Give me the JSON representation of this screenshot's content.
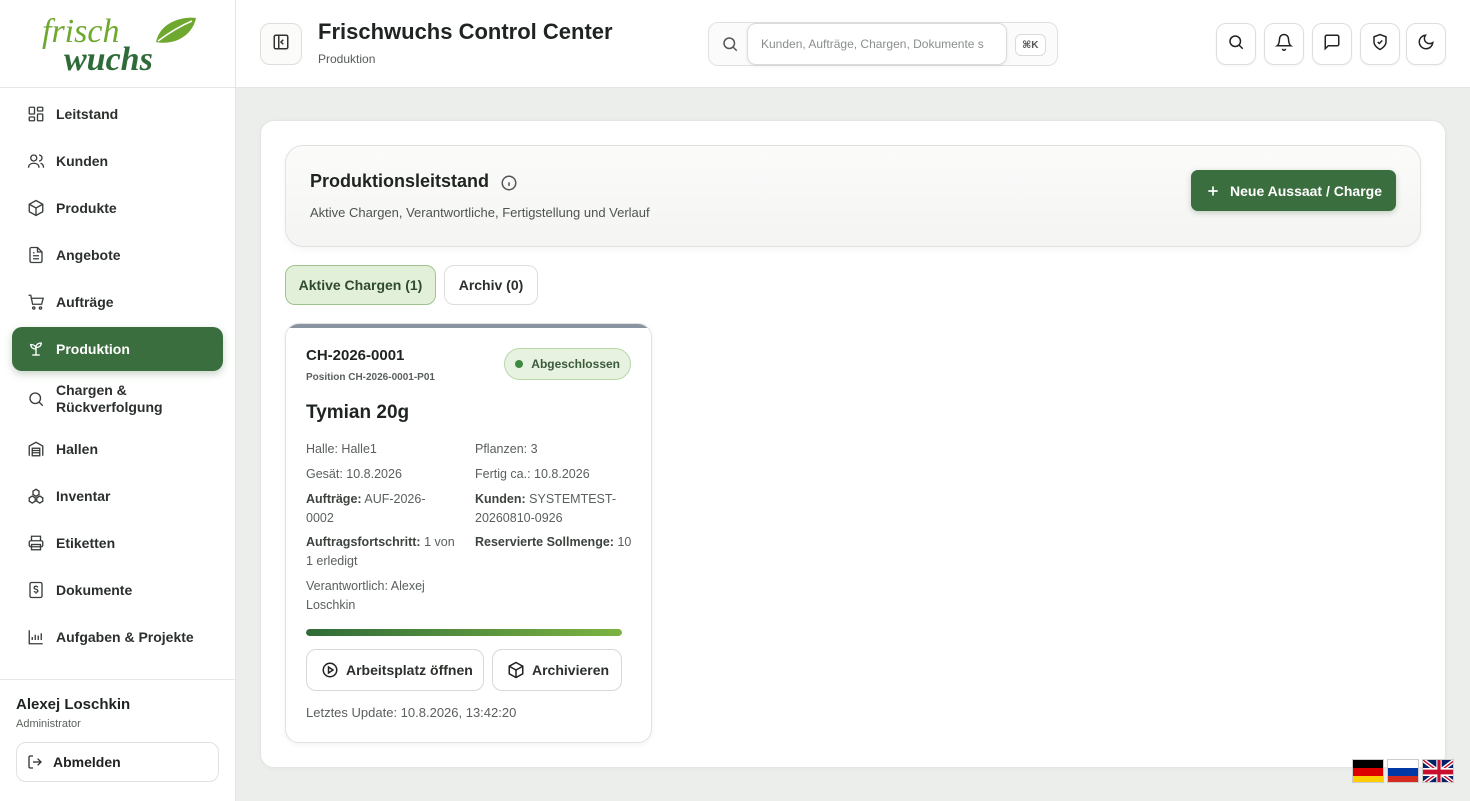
{
  "logo": {
    "line1": "frisch",
    "line2": "wuchs"
  },
  "sidebar": {
    "items": [
      {
        "label": "Leitstand",
        "icon": "dashboard-icon"
      },
      {
        "label": "Kunden",
        "icon": "users-icon"
      },
      {
        "label": "Produkte",
        "icon": "package-icon"
      },
      {
        "label": "Angebote",
        "icon": "document-icon"
      },
      {
        "label": "Aufträge",
        "icon": "cart-icon"
      },
      {
        "label": "Produktion",
        "icon": "sprout-icon",
        "active": true
      },
      {
        "label": "Chargen & Rückverfolgung",
        "icon": "search-icon"
      },
      {
        "label": "Hallen",
        "icon": "warehouse-icon"
      },
      {
        "label": "Inventar",
        "icon": "boxes-icon"
      },
      {
        "label": "Etiketten",
        "icon": "printer-icon"
      },
      {
        "label": "Dokumente",
        "icon": "receipt-icon"
      },
      {
        "label": "Aufgaben & Projekte",
        "icon": "chart-icon"
      }
    ]
  },
  "user": {
    "name": "Alexej Loschkin",
    "role": "Administrator",
    "logout_label": "Abmelden"
  },
  "header": {
    "title": "Frischwuchs Control Center",
    "subtitle": "Produktion",
    "search_placeholder": "Kunden, Aufträge, Chargen, Dokumente s",
    "shortcut": "⌘K"
  },
  "section": {
    "title": "Produktionsleitstand",
    "subtitle": "Aktive Chargen, Verantwortliche, Fertigstellung und Verlauf",
    "new_button": "Neue Aussaat / Charge"
  },
  "tabs": {
    "active": "Aktive Chargen (1)",
    "archive": "Archiv (0)"
  },
  "batch": {
    "id": "CH-2026-0001",
    "position": "Position CH-2026-0001-P01",
    "status": "Abgeschlossen",
    "product": "Tymian 20g",
    "hall": "Halle: Halle1",
    "plants": "Pflanzen: 3",
    "sown": "Gesät: 10.8.2026",
    "ready": "Fertig ca.: 10.8.2026",
    "orders_label": "Aufträge:",
    "orders_value": "AUF-2026-0002",
    "customers_label": "Kunden:",
    "customers_value": "SYSTEMTEST-20260810-0926",
    "progress_label": "Auftragsfortschritt:",
    "progress_value": "1 von 1 erledigt",
    "reserved_label": "Reservierte Sollmenge:",
    "reserved_value": "10",
    "responsible": "Verantwortlich: Alexej Loschkin",
    "progress_fraction": 1.0,
    "open_button": "Arbeitsplatz öffnen",
    "archive_button": "Archivieren",
    "last_update": "Letztes Update: 10.8.2026, 13:42:20"
  },
  "colors": {
    "brand_green": "#3b6e3e",
    "logo_green": "#6fa82f",
    "logo_dark": "#2f6b38"
  }
}
